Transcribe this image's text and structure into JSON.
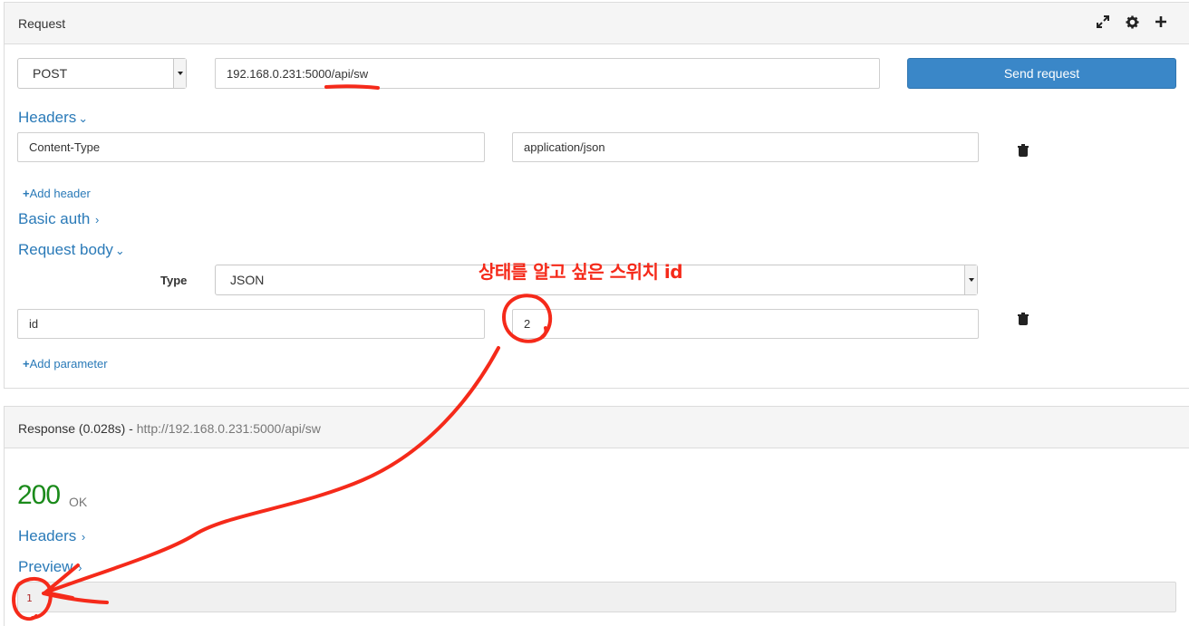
{
  "request": {
    "title": "Request",
    "method": "POST",
    "url_prefix": "192.168.0.231:5000",
    "url_path": "/api/sw",
    "send_label": "Send request",
    "headers_label": "Headers",
    "headers": [
      {
        "name": "Content-Type",
        "value": "application/json"
      }
    ],
    "add_header_label": "Add header",
    "basic_auth_label": "Basic auth",
    "body_label": "Request body",
    "type_label": "Type",
    "body_type": "JSON",
    "params": [
      {
        "name": "id",
        "value": "2"
      }
    ],
    "add_param_label": "Add parameter"
  },
  "response": {
    "title": "Response (0.028s)",
    "separator": " - ",
    "url": "http://192.168.0.231:5000/api/sw",
    "status_code": "200",
    "status_text": "OK",
    "headers_label": "Headers",
    "preview_label": "Preview",
    "preview_value": "1"
  },
  "annotation": {
    "text": "상태를 알고 싶은 스위치 id",
    "color": "#f52a1a"
  },
  "colors": {
    "accent": "#3a87c8",
    "link": "#2a7ab8",
    "status_ok": "#1a8a1a"
  },
  "icons": [
    "expand-icon",
    "gear-icon",
    "plus-icon",
    "trash-icon",
    "chevron-down-icon",
    "chevron-right-icon"
  ]
}
